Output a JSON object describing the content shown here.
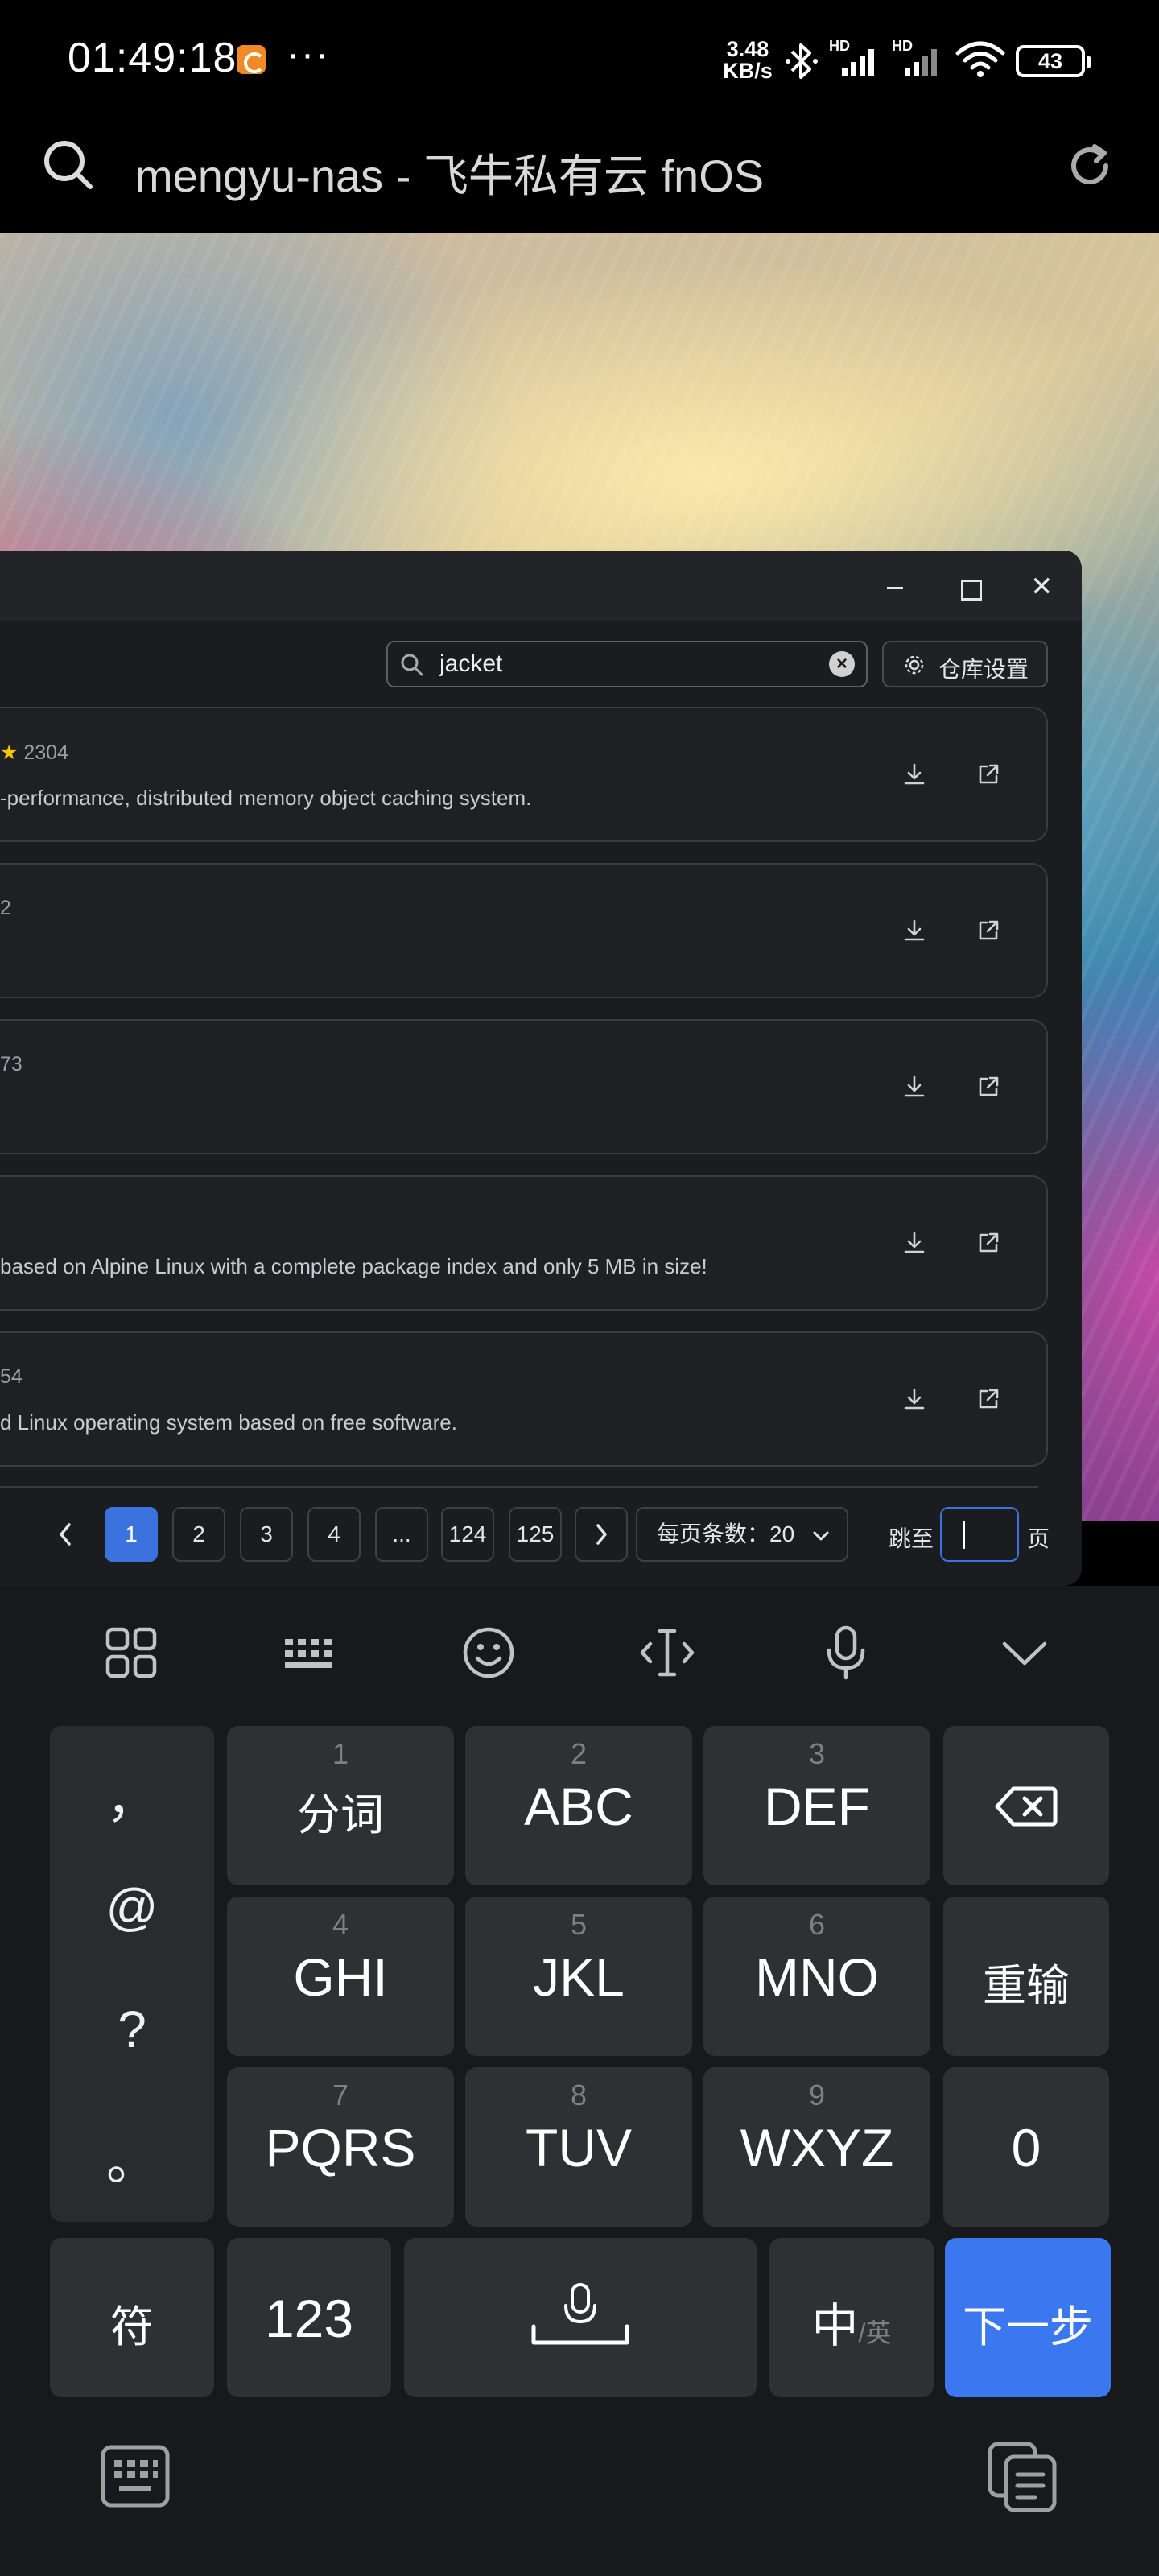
{
  "status_bar": {
    "time": "01:49:18",
    "more": "···",
    "net_speed_value": "3.48",
    "net_speed_unit": "KB/s",
    "signal_1": "HD",
    "signal_2": "HD",
    "battery": "43"
  },
  "browser": {
    "page_title": "mengyu-nas - 飞牛私有云 fnOS"
  },
  "app": {
    "search": {
      "value": "jacket",
      "placeholder": ""
    },
    "repo_settings_label": "仓库设置",
    "cards": [
      {
        "meta": "2304",
        "starred": true,
        "desc": "-performance, distributed memory object caching system."
      },
      {
        "meta": "2",
        "starred": false,
        "desc": ""
      },
      {
        "meta": "73",
        "starred": false,
        "desc": ""
      },
      {
        "meta": "",
        "starred": false,
        "desc": "based on Alpine Linux with a complete package index and only 5 MB in size!"
      },
      {
        "meta": "54",
        "starred": false,
        "desc": "d Linux operating system based on free software."
      }
    ],
    "pagination": {
      "pages": [
        "1",
        "2",
        "3",
        "4",
        "...",
        "124",
        "125"
      ],
      "active_page": "1",
      "per_page_label": "每页条数：20",
      "jump_label": "跳至",
      "page_suffix": "页"
    }
  },
  "keyboard": {
    "punctuation": [
      "，",
      "@",
      "?",
      "。"
    ],
    "keys": [
      {
        "num": "1",
        "label": "分词"
      },
      {
        "num": "2",
        "label": "ABC"
      },
      {
        "num": "3",
        "label": "DEF"
      },
      {
        "num": "4",
        "label": "GHI"
      },
      {
        "num": "5",
        "label": "JKL"
      },
      {
        "num": "6",
        "label": "MNO"
      },
      {
        "num": "7",
        "label": "PQRS"
      },
      {
        "num": "8",
        "label": "TUV"
      },
      {
        "num": "9",
        "label": "WXYZ"
      }
    ],
    "reenter_label": "重输",
    "zero_label": "0",
    "symbols_label": "符",
    "numbers_label": "123",
    "lang_main": "中",
    "lang_alt": "/英",
    "next_label": "下一步"
  },
  "colors": {
    "accent": "#3b72de",
    "next_key": "#3b78ef",
    "star": "#f5c400",
    "window_bg": "#1b1c1f",
    "keyboard_bg": "#18191b"
  }
}
